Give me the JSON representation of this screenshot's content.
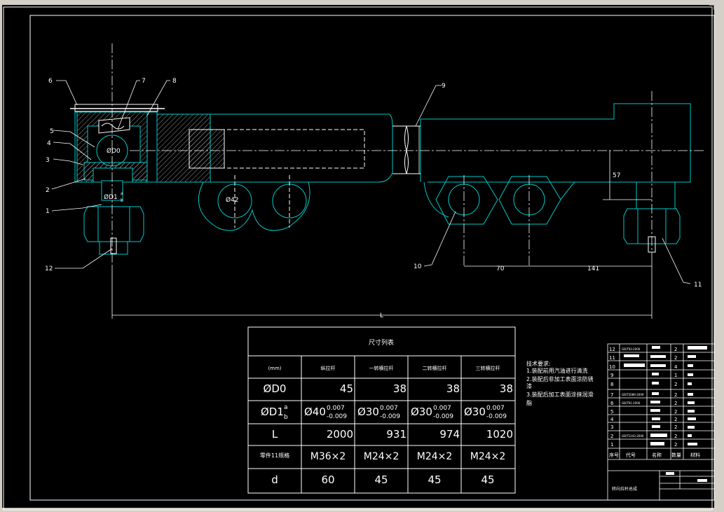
{
  "colors": {
    "background": "#000000",
    "line": "#ffffff",
    "part_outline": "#00c8c8",
    "hatch": "#c8c8c8"
  },
  "leaders": [
    "1",
    "2",
    "3",
    "4",
    "5",
    "6",
    "7",
    "8",
    "9",
    "10",
    "11",
    "12"
  ],
  "labels": {
    "d0": "ØD0",
    "d1": "ØD1",
    "d1_sup": "a",
    "d1_sub": "b",
    "dia42": "Ø42",
    "dim57": "57",
    "dim70": "70",
    "dim141": "141",
    "dimL": "L"
  },
  "size_table": {
    "title": "尺寸列表",
    "headers": [
      "(mm)",
      "纵拉杆",
      "一转横拉杆",
      "二转横拉杆",
      "三转横拉杆"
    ],
    "rows": [
      {
        "name": "ØD0",
        "values": [
          "45",
          "38",
          "38",
          "38"
        ]
      },
      {
        "name": "ØD1",
        "name_sup": "a",
        "name_sub": "b",
        "values": [
          {
            "base": "Ø40",
            "sup": "0.007",
            "sub": "-0.009"
          },
          {
            "base": "Ø30",
            "sup": "0.007",
            "sub": "-0.009"
          },
          {
            "base": "Ø30",
            "sup": "0.007",
            "sub": "-0.009"
          },
          {
            "base": "Ø30",
            "sup": "0.007",
            "sub": "-0.009"
          }
        ]
      },
      {
        "name": "L",
        "values": [
          "2000",
          "931",
          "974",
          "1020"
        ]
      },
      {
        "name": "零件11规格",
        "values": [
          "M36×2",
          "M24×2",
          "M24×2",
          "M24×2"
        ]
      },
      {
        "name": "d",
        "values": [
          "60",
          "45",
          "45",
          "45"
        ]
      }
    ]
  },
  "tech_requirements": {
    "title": "技术要求:",
    "lines": [
      "1.装配前用汽油进行清洗",
      "2.装配后非加工表面涂防锈",
      "漆",
      "3.装配后加工表面涂抹润滑",
      "脂"
    ]
  },
  "bom": {
    "rows": [
      {
        "no": "12",
        "code": "GB/T93-2000",
        "qty": "2"
      },
      {
        "no": "11",
        "code": "",
        "qty": "2"
      },
      {
        "no": "10",
        "code": "",
        "qty": "4"
      },
      {
        "no": "9",
        "code": "",
        "qty": "1"
      },
      {
        "no": "8",
        "code": "",
        "qty": "2"
      },
      {
        "no": "7",
        "code": "GB/T2089-2009",
        "qty": "2"
      },
      {
        "no": "6",
        "code": "GB/T91-2000",
        "qty": "2"
      },
      {
        "no": "5",
        "code": "",
        "qty": "2"
      },
      {
        "no": "4",
        "code": "",
        "qty": "2"
      },
      {
        "no": "3",
        "code": "",
        "qty": "2"
      },
      {
        "no": "2",
        "code": "GB/T1243-2006",
        "qty": "2"
      },
      {
        "no": "1",
        "code": "",
        "qty": "2"
      }
    ],
    "header": [
      "序号",
      "代号",
      "名称",
      "数量",
      "材料"
    ],
    "title_block_name": "转向拉杆总成"
  }
}
